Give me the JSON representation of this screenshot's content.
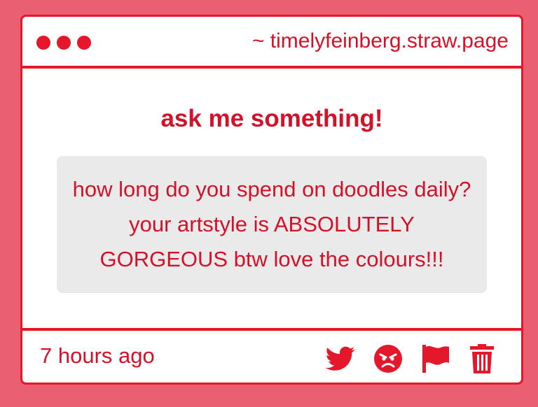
{
  "window": {
    "url": "~ timelyfeinberg.straw.page"
  },
  "content": {
    "heading": "ask me something!",
    "question": "how long do you spend on doodles daily? your artstyle is ABSOLUTELY GORGEOUS btw love the colours!!!"
  },
  "footer": {
    "timestamp": "7 hours ago",
    "actions": [
      {
        "icon": "twitter-bird-icon"
      },
      {
        "icon": "angry-face-icon"
      },
      {
        "icon": "flag-icon"
      },
      {
        "icon": "trash-icon"
      }
    ]
  },
  "colors": {
    "background": "#ea5f72",
    "accent": "#e4172b",
    "text": "#d3122a",
    "question_box": "#ebeaeb",
    "window": "#ffffff"
  }
}
